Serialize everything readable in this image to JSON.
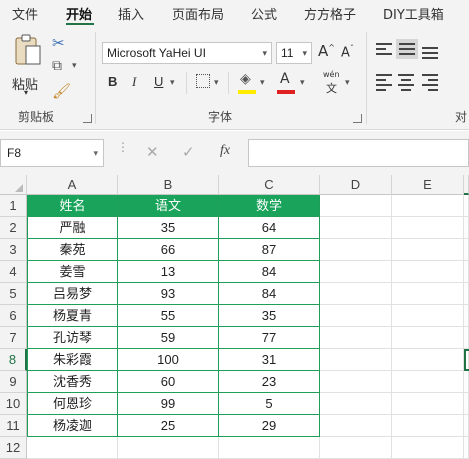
{
  "tabs": [
    "文件",
    "开始",
    "插入",
    "页面布局",
    "公式",
    "方方格子",
    "DIY工具箱"
  ],
  "ribbon": {
    "clipboard": {
      "paste_label": "粘贴",
      "group_label": "剪贴板"
    },
    "font": {
      "font_name": "Microsoft YaHei UI",
      "font_size": "11",
      "bold": "B",
      "italic": "I",
      "underline": "U",
      "grow": "A",
      "shrink": "A",
      "font_color_glyph": "A",
      "phonetic_glyph": "wén",
      "group_label": "字体"
    },
    "align": {
      "group_label": "对"
    }
  },
  "formula_bar": {
    "name_box": "F8",
    "fx": "fx",
    "formula": ""
  },
  "columns": [
    "A",
    "B",
    "C",
    "D",
    "E"
  ],
  "rows": [
    "1",
    "2",
    "3",
    "4",
    "5",
    "6",
    "7",
    "8",
    "9",
    "10",
    "11",
    "12"
  ],
  "table": {
    "headers": [
      "姓名",
      "语文",
      "数学"
    ],
    "rows": [
      [
        "严融",
        "35",
        "64"
      ],
      [
        "秦苑",
        "66",
        "87"
      ],
      [
        "姜雪",
        "13",
        "84"
      ],
      [
        "吕易梦",
        "93",
        "84"
      ],
      [
        "杨夏青",
        "55",
        "35"
      ],
      [
        "孔访琴",
        "59",
        "77"
      ],
      [
        "朱彩霞",
        "100",
        "31"
      ],
      [
        "沈香秀",
        "60",
        "23"
      ],
      [
        "何恩珍",
        "99",
        "5"
      ],
      [
        "杨凌迦",
        "25",
        "29"
      ]
    ]
  },
  "colors": {
    "header_fill": "#1aa35a",
    "table_border": "#1e9e57",
    "accent": "#217346"
  }
}
